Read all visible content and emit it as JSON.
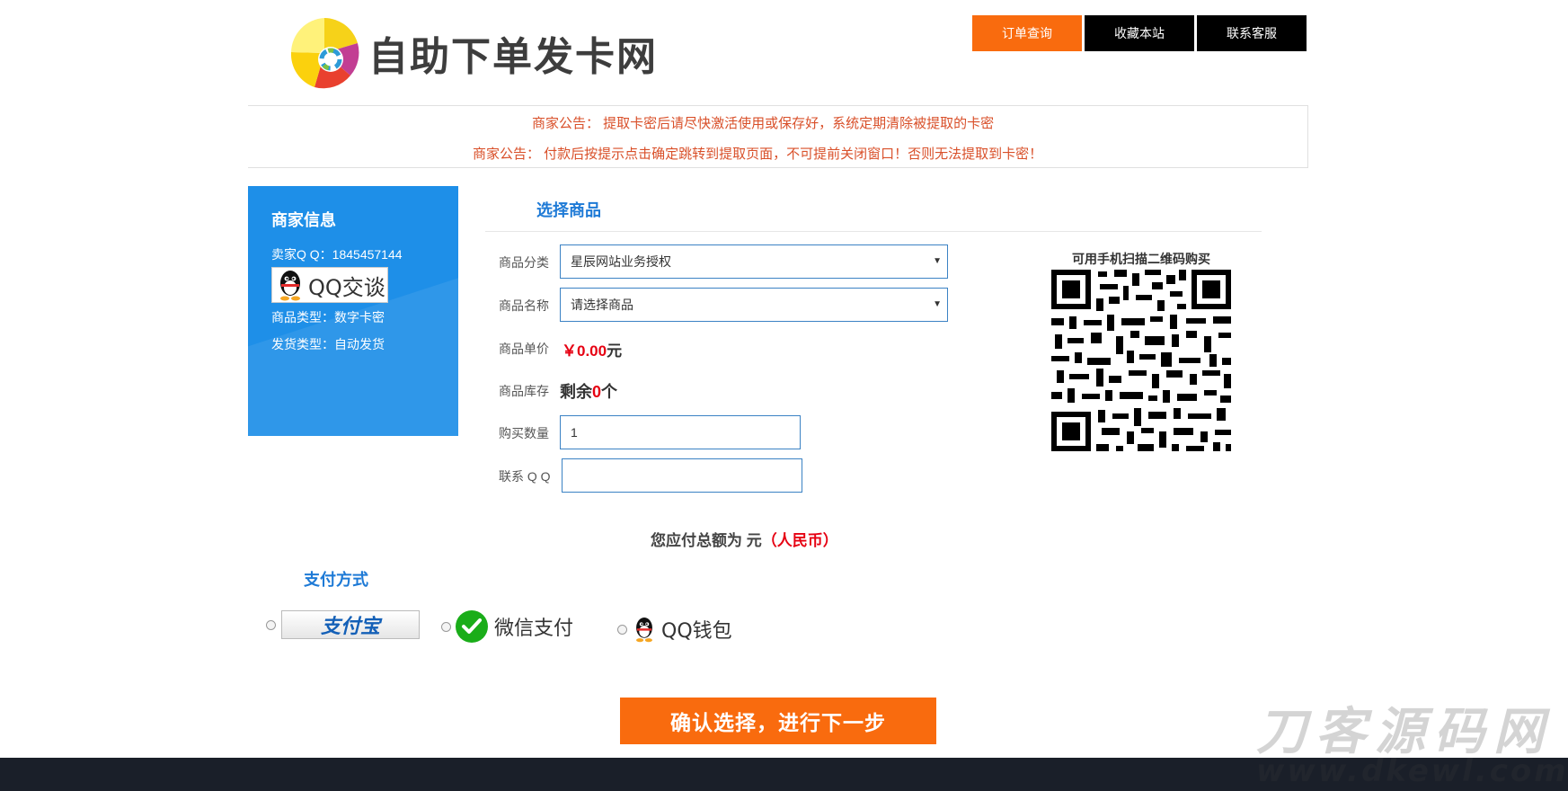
{
  "header": {
    "site_title": "自助下单发卡网",
    "nav": [
      "订单查询",
      "收藏本站",
      "联系客服"
    ]
  },
  "notices": [
    "商家公告： 提取卡密后请尽快激活使用或保存好，系统定期清除被提取的卡密",
    "商家公告： 付款后按提示点击确定跳转到提取页面，不可提前关闭窗口！否则无法提取到卡密！"
  ],
  "merchant": {
    "title": "商家信息",
    "qq_line": "卖家Q Q：1845457144",
    "chat_label": "QQ交谈",
    "product_type": "商品类型：数字卡密",
    "delivery_type": "发货类型：自动发货"
  },
  "product": {
    "section_title": "选择商品",
    "category_label": "商品分类",
    "category_value": "星辰网站业务授权",
    "name_label": "商品名称",
    "name_value": "请选择商品",
    "price_label": "商品单价",
    "price_value": "￥0.00",
    "price_unit": "元",
    "stock_label": "商品库存",
    "stock_prefix": "剩余",
    "stock_count": "0",
    "stock_suffix": "个",
    "quantity_label": "购买数量",
    "quantity_value": "1",
    "contact_label": "联系 Q Q",
    "contact_value": ""
  },
  "qr": {
    "caption": "可用手机扫描二维码购买"
  },
  "total": {
    "prefix": "您应付总额为 元",
    "currency": "（人民币）"
  },
  "payment": {
    "title": "支付方式",
    "alipay_label": "支付宝",
    "wechat_label": "微信支付",
    "qqwallet_label": "QQ钱包"
  },
  "submit_label": "确认选择，进行下一步",
  "watermark": {
    "line1": "刀客源码网",
    "line2": "www.dkewl.com"
  },
  "colors": {
    "accent_orange": "#f96b0e",
    "merchant_blue": "#1e8fe8",
    "price_red": "#e60012",
    "notice_red": "#d9502a"
  }
}
